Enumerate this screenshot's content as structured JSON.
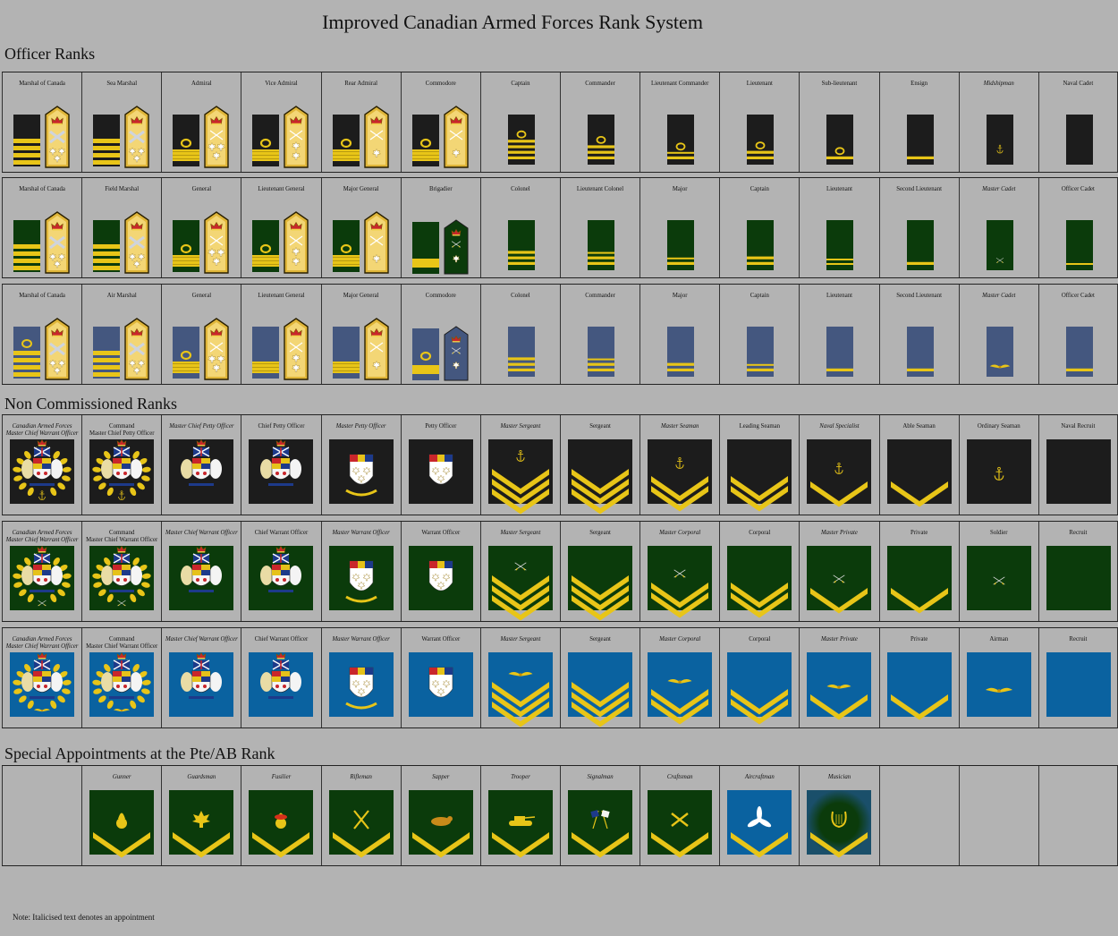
{
  "title": "Improved Canadian Armed Forces Rank System",
  "sections": {
    "officer": "Officer Ranks",
    "ncm": "Non Commissioned Ranks",
    "special": "Special Appointments at the Pte/AB Rank"
  },
  "note": "Note: Italicised text denotes an appointment",
  "colors": {
    "background": "#b3b3b3",
    "navy": "#1c1c1c",
    "army": "#0b3b0b",
    "air_officer": "#44577f",
    "air_ncm": "#0a62a0",
    "gold": "#e8c518"
  },
  "rows": [
    {
      "id": "navy-officers",
      "service": "navy",
      "cells": [
        {
          "label": "Marshal of Canada",
          "insignia": "board-crown-baton",
          "bars": "wide4"
        },
        {
          "label": "Sea Marshal",
          "insignia": "board-crown-baton",
          "bars": "wide4"
        },
        {
          "label": "Admiral",
          "insignia": "board-crown-3leaf",
          "bars": "wide1-loop"
        },
        {
          "label": "Vice Admiral",
          "insignia": "board-crown-2leaf",
          "bars": "wide1-loop"
        },
        {
          "label": "Rear Admiral",
          "insignia": "board-crown-1leaf",
          "bars": "wide1-loop"
        },
        {
          "label": "Commodore",
          "insignia": "board-crown-1leaf",
          "bars": "wide1-loop"
        },
        {
          "label": "Captain",
          "insignia": "slip",
          "bars": "4-loop"
        },
        {
          "label": "Commander",
          "insignia": "slip",
          "bars": "3-loop"
        },
        {
          "label": "Lieutenant Commander",
          "insignia": "slip",
          "bars": "2h-loop"
        },
        {
          "label": "Lieutenant",
          "insignia": "slip",
          "bars": "2-loop"
        },
        {
          "label": "Sub-lieutenant",
          "insignia": "slip",
          "bars": "1-loop"
        },
        {
          "label": "Ensign",
          "insignia": "slip",
          "bars": "1"
        },
        {
          "label": "Midshipman",
          "insignia": "slip-anchor",
          "bars": "0",
          "italic": true
        },
        {
          "label": "Naval Cadet",
          "insignia": "slip",
          "bars": "0"
        }
      ]
    },
    {
      "id": "army-officers",
      "service": "army",
      "cells": [
        {
          "label": "Marshal of Canada",
          "insignia": "board-crown-baton",
          "bars": "wide4"
        },
        {
          "label": "Field Marshal",
          "insignia": "board-crown-baton",
          "bars": "wide4"
        },
        {
          "label": "General",
          "insignia": "board-crown-3leaf",
          "bars": "wide1-loop"
        },
        {
          "label": "Lieutenant General",
          "insignia": "board-crown-2leaf",
          "bars": "wide1-loop"
        },
        {
          "label": "Major General",
          "insignia": "board-crown-1leaf",
          "bars": "wide1-loop"
        },
        {
          "label": "Brigadier",
          "insignia": "board-green",
          "bars": "wide1"
        },
        {
          "label": "Colonel",
          "insignia": "slip",
          "bars": "3"
        },
        {
          "label": "Lieutenant Colonel",
          "insignia": "slip",
          "bars": "3h"
        },
        {
          "label": "Major",
          "insignia": "slip",
          "bars": "2h"
        },
        {
          "label": "Captain",
          "insignia": "slip",
          "bars": "2"
        },
        {
          "label": "Lieutenant",
          "insignia": "slip",
          "bars": "2t"
        },
        {
          "label": "Second Lieutenant",
          "insignia": "slip",
          "bars": "1"
        },
        {
          "label": "Master Cadet",
          "insignia": "slip-swords",
          "bars": "0",
          "italic": true
        },
        {
          "label": "Officer Cadet",
          "insignia": "slip",
          "bars": "1t"
        }
      ]
    },
    {
      "id": "air-officers",
      "service": "air_officer",
      "cells": [
        {
          "label": "Marshal of Canada",
          "insignia": "board-crown-baton",
          "bars": "wide4-loop"
        },
        {
          "label": "Air Marshal",
          "insignia": "board-crown-baton",
          "bars": "wide4"
        },
        {
          "label": "General",
          "insignia": "board-crown-3leaf",
          "bars": "wide1-loop"
        },
        {
          "label": "Lieutenant General",
          "insignia": "board-crown-2leaf",
          "bars": "wide1"
        },
        {
          "label": "Major General",
          "insignia": "board-crown-1leaf",
          "bars": "wide1"
        },
        {
          "label": "Commodore",
          "insignia": "board-blue",
          "bars": "wide1-loop"
        },
        {
          "label": "Colonel",
          "insignia": "slip",
          "bars": "3"
        },
        {
          "label": "Commander",
          "insignia": "slip",
          "bars": "3h"
        },
        {
          "label": "Major",
          "insignia": "slip",
          "bars": "2"
        },
        {
          "label": "Captain",
          "insignia": "slip",
          "bars": "2h"
        },
        {
          "label": "Lieutenant",
          "insignia": "slip",
          "bars": "1"
        },
        {
          "label": "Second Lieutenant",
          "insignia": "slip",
          "bars": "1"
        },
        {
          "label": "Master Cadet",
          "insignia": "slip-wings",
          "bars": "0",
          "italic": true
        },
        {
          "label": "Officer Cadet",
          "insignia": "slip",
          "bars": "1"
        }
      ]
    },
    {
      "id": "navy-ncm",
      "service": "navy",
      "cells": [
        {
          "label": "Canadian Armed Forces\nMaster Chief Warrant Officer",
          "insignia": "arms-wreath",
          "italic": true
        },
        {
          "label": "Command\nMaster Chief Petty Officer",
          "insignia": "arms-wreath"
        },
        {
          "label": "Master Chief Petty Officer",
          "insignia": "arms",
          "italic": true
        },
        {
          "label": "Chief Petty Officer",
          "insignia": "arms"
        },
        {
          "label": "Master Petty Officer",
          "insignia": "shield-wreath",
          "italic": true
        },
        {
          "label": "Petty Officer",
          "insignia": "shield"
        },
        {
          "label": "Master Sergeant",
          "insignia": "chev3-anchor",
          "italic": true
        },
        {
          "label": "Sergeant",
          "insignia": "chev3"
        },
        {
          "label": "Master Seaman",
          "insignia": "chev2-anchor",
          "italic": true
        },
        {
          "label": "Leading Seaman",
          "insignia": "chev2"
        },
        {
          "label": "Naval Specialist",
          "insignia": "chev1-anchor",
          "italic": true
        },
        {
          "label": "Able Seaman",
          "insignia": "chev1"
        },
        {
          "label": "Ordinary Seaman",
          "insignia": "anchor"
        },
        {
          "label": "Naval Recruit",
          "insignia": "blank"
        }
      ]
    },
    {
      "id": "army-ncm",
      "service": "army",
      "cells": [
        {
          "label": "Canadian Armed Forces\nMaster Chief Warrant Officer",
          "insignia": "arms-wreath",
          "italic": true
        },
        {
          "label": "Command\nMaster Chief Warrant Officer",
          "insignia": "arms-wreath"
        },
        {
          "label": "Master Chief Warrant Officer",
          "insignia": "arms",
          "italic": true
        },
        {
          "label": "Chief Warrant Officer",
          "insignia": "arms"
        },
        {
          "label": "Master Warrant Officer",
          "insignia": "shield-wreath",
          "italic": true
        },
        {
          "label": "Warrant Officer",
          "insignia": "shield"
        },
        {
          "label": "Master Sergeant",
          "insignia": "chev3-swords",
          "italic": true
        },
        {
          "label": "Sergeant",
          "insignia": "chev3"
        },
        {
          "label": "Master Corporal",
          "insignia": "chev2-swords",
          "italic": true
        },
        {
          "label": "Corporal",
          "insignia": "chev2"
        },
        {
          "label": "Master Private",
          "insignia": "chev1-swords",
          "italic": true
        },
        {
          "label": "Private",
          "insignia": "chev1"
        },
        {
          "label": "Soldier",
          "insignia": "swords"
        },
        {
          "label": "Recruit",
          "insignia": "blank"
        }
      ]
    },
    {
      "id": "air-ncm",
      "service": "air_ncm",
      "cells": [
        {
          "label": "Canadian Armed Forces\nMaster Chief Warrant Officer",
          "insignia": "arms-wreath",
          "italic": true
        },
        {
          "label": "Command\nMaster Chief Warrant Officer",
          "insignia": "arms-wreath"
        },
        {
          "label": "Master Chief Warrant Officer",
          "insignia": "arms",
          "italic": true
        },
        {
          "label": "Chief Warrant Officer",
          "insignia": "arms"
        },
        {
          "label": "Master Warrant Officer",
          "insignia": "shield-wreath",
          "italic": true
        },
        {
          "label": "Warrant Officer",
          "insignia": "shield"
        },
        {
          "label": "Master Sergeant",
          "insignia": "chev3-wings",
          "italic": true
        },
        {
          "label": "Sergeant",
          "insignia": "chev3"
        },
        {
          "label": "Master Corporal",
          "insignia": "chev2-wings",
          "italic": true
        },
        {
          "label": "Corporal",
          "insignia": "chev2"
        },
        {
          "label": "Master Private",
          "insignia": "chev1-wings",
          "italic": true
        },
        {
          "label": "Private",
          "insignia": "chev1"
        },
        {
          "label": "Airman",
          "insignia": "wings"
        },
        {
          "label": "Recruit",
          "insignia": "blank"
        }
      ]
    },
    {
      "id": "special",
      "service": "army",
      "cells": [
        {
          "label": "",
          "insignia": "none"
        },
        {
          "label": "Gunner",
          "insignia": "chev1-grenade",
          "italic": true
        },
        {
          "label": "Guardsman",
          "insignia": "chev1-leaf",
          "italic": true
        },
        {
          "label": "Fusilier",
          "insignia": "chev1-grenade2",
          "italic": true
        },
        {
          "label": "Rifleman",
          "insignia": "chev1-rifles",
          "italic": true
        },
        {
          "label": "Sapper",
          "insignia": "chev1-beaver",
          "italic": true
        },
        {
          "label": "Trooper",
          "insignia": "chev1-tank",
          "italic": true
        },
        {
          "label": "Signalman",
          "insignia": "chev1-flags",
          "italic": true
        },
        {
          "label": "Craftsman",
          "insignia": "chev1-tools",
          "italic": true
        },
        {
          "label": "Aircraftman",
          "insignia": "chev1-prop",
          "italic": true,
          "service": "air_ncm"
        },
        {
          "label": "Musician",
          "insignia": "chev1-lyre",
          "italic": true
        },
        {
          "label": "",
          "insignia": "none"
        },
        {
          "label": "",
          "insignia": "none"
        },
        {
          "label": "",
          "insignia": "none"
        }
      ]
    }
  ]
}
